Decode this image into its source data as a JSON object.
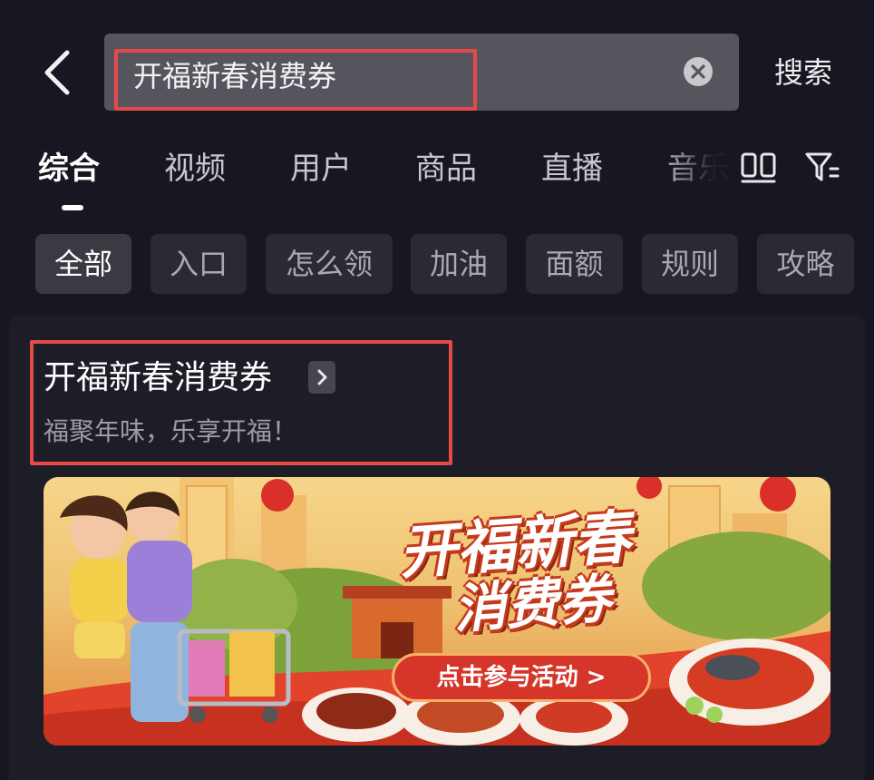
{
  "search": {
    "query": "开福新春消费券",
    "button_label": "搜索"
  },
  "tabs": [
    {
      "label": "综合"
    },
    {
      "label": "视频"
    },
    {
      "label": "用户"
    },
    {
      "label": "商品"
    },
    {
      "label": "直播"
    },
    {
      "label": "音乐"
    }
  ],
  "chips": [
    {
      "label": "全部"
    },
    {
      "label": "入口"
    },
    {
      "label": "怎么领"
    },
    {
      "label": "加油"
    },
    {
      "label": "面额"
    },
    {
      "label": "规则"
    },
    {
      "label": "攻略"
    }
  ],
  "result_card": {
    "title": "开福新春消费券",
    "subtitle": "福聚年味，乐享开福！",
    "banner": {
      "title_line1": "开福新春",
      "title_line2": "消费券",
      "cta_label": "点击参与活动 >"
    }
  },
  "icons": {
    "back": "chevron-left-icon",
    "clear": "clear-circle-icon",
    "layout": "double-column-icon",
    "filter": "filter-icon",
    "title_arrow": "chevron-right-icon"
  },
  "colors": {
    "background": "#161720",
    "highlight_border": "#e5494a",
    "chip_active": "#3a3b42",
    "chip": "#2a2b32"
  }
}
